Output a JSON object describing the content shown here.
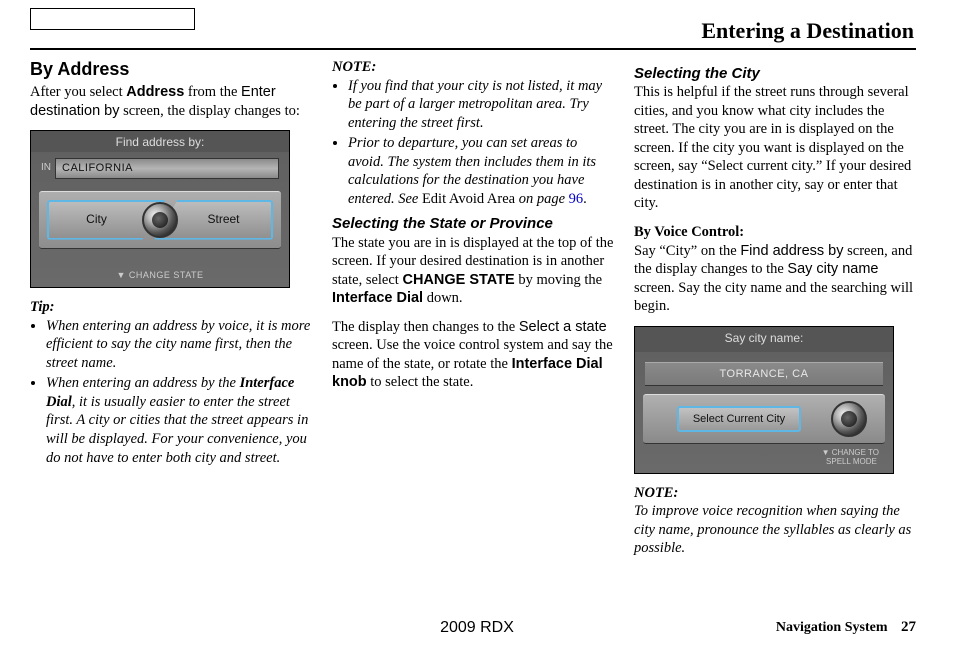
{
  "header_title": "Entering a Destination",
  "col1": {
    "heading": "By Address",
    "intro_1": "After you select ",
    "intro_address": "Address",
    "intro_2": " from the ",
    "intro_screen": "Enter destination by",
    "intro_3": " screen, the display changes to:",
    "screen1": {
      "title": "Find address by:",
      "in_label": "IN",
      "state": "CALIFORNIA",
      "city_btn": "City",
      "street_btn": "Street",
      "change_state": "▼ CHANGE STATE"
    },
    "tip_label": "Tip:",
    "tip1": "When entering an address by voice, it is more efficient to say the city name first, then the street name.",
    "tip2_a": "When entering an address by the ",
    "tip2_dial": "Interface Dial",
    "tip2_b": ", it is usually easier to enter the street first. A city or cities that the street appears in will be displayed. For your convenience, you do not have to enter both city and street."
  },
  "col2": {
    "note_label": "NOTE:",
    "note1": "If you find that your city is not listed, it may be part of a larger metropolitan area. Try entering the street first.",
    "note2_a": "Prior to departure, you can set areas to avoid. The system then includes them in its calculations for the destination you have entered. See ",
    "note2_edit": "Edit Avoid Area",
    "note2_b": " on page ",
    "note2_page": "96",
    "note2_c": ".",
    "sub1": "Selecting the State or Province",
    "p1_a": "The state you are in is displayed at the top of the screen. If your desired destination is in another state, select ",
    "p1_change": "CHANGE STATE",
    "p1_b": " by moving the ",
    "p1_dial": "Interface Dial",
    "p1_c": " down.",
    "p2_a": "The display then changes to the ",
    "p2_select": "Select a state",
    "p2_b": " screen. Use the voice control system and say the name of the state, or rotate the ",
    "p2_knob": "Interface Dial knob",
    "p2_c": " to select the state."
  },
  "col3": {
    "sub1": "Selecting the City",
    "p1": "This is helpful if the street runs through several cities, and you know what city includes the street. The city you are in is displayed on the screen. If the city you want is displayed on the screen, say “Select current city.” If your desired destination is in another city, say or enter that city.",
    "voice_label": "By Voice Control:",
    "p2_a": "Say “City” on the ",
    "p2_find": "Find address by",
    "p2_b": " screen, and the display changes to the ",
    "p2_say": "Say city name",
    "p2_c": " screen. Say the city name and the searching will begin.",
    "screen2": {
      "title": "Say city name:",
      "city": "TORRANCE, CA",
      "select_btn": "Select Current City",
      "change": "▼ CHANGE TO\n  SPELL MODE"
    },
    "note_label": "NOTE:",
    "note": "To improve voice recognition when saying the city name, pronounce the syllables as clearly as possible."
  },
  "footer": {
    "center": "2009  RDX",
    "navsys": "Navigation System",
    "page": "27"
  }
}
